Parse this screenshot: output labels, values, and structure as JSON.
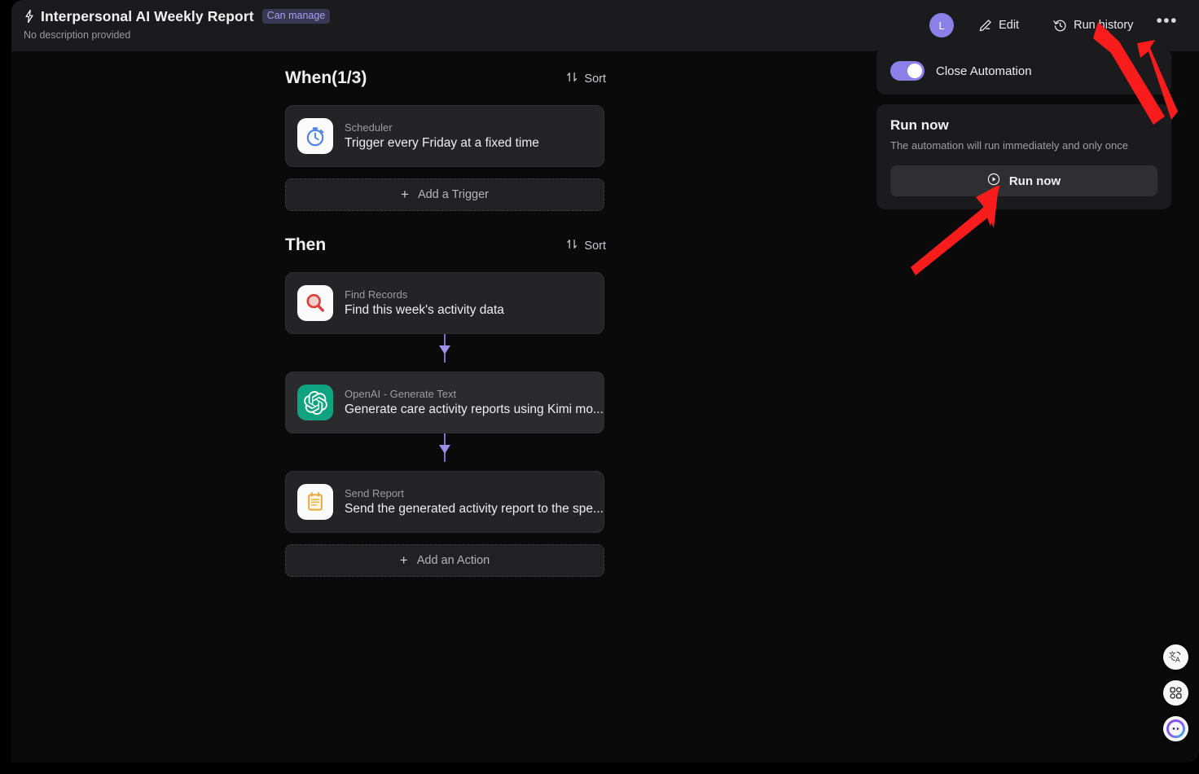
{
  "header": {
    "bolt_icon": "lightning-bolt-icon",
    "title": "Interpersonal AI Weekly Report",
    "badge": "Can manage",
    "subtitle": "No description provided",
    "avatar_initial": "L",
    "edit_label": "Edit",
    "run_history_label": "Run history",
    "more_label": "•••"
  },
  "when_section": {
    "title": "When(1/3)",
    "sort_label": "Sort",
    "cards": [
      {
        "kicker": "Scheduler",
        "desc": "Trigger every Friday at a fixed time",
        "icon": "stopwatch-icon"
      }
    ],
    "add_label": "Add a Trigger",
    "plus": "+"
  },
  "then_section": {
    "title": "Then",
    "sort_label": "Sort",
    "cards": [
      {
        "kicker": "Find Records",
        "desc": "Find this week's activity data",
        "icon": "magnifier-icon"
      },
      {
        "kicker": "OpenAI - Generate Text",
        "desc": "Generate care activity reports using Kimi mo...",
        "icon": "openai-icon"
      },
      {
        "kicker": "Send Report",
        "desc": "Send the generated activity report to the spe...",
        "icon": "clipboard-icon"
      }
    ],
    "add_label": "Add an Action",
    "plus": "+"
  },
  "right_panel": {
    "toggle_label": "Close Automation",
    "toggle_on": "on",
    "run_now_title": "Run now",
    "run_now_sub": "The automation will run immediately and only once",
    "run_now_button": "Run now"
  },
  "fabs": [
    {
      "name": "translate-icon"
    },
    {
      "name": "apps-grid-icon"
    },
    {
      "name": "assistant-avatar-icon"
    }
  ],
  "colors": {
    "accent_purple": "#8b7fe8",
    "connector_purple": "#7b6fd4",
    "badge_text": "#a99df2",
    "annotation_red": "#f91c1c",
    "openai_green": "#10a37f",
    "panel_bg": "#1b1b1d",
    "card_bg": "#242426",
    "canvas_bg": "#0a0a0a"
  }
}
